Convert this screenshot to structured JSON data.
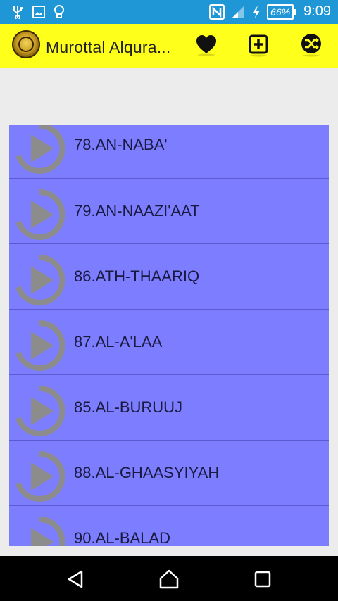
{
  "status_bar": {
    "battery_percent": "66%",
    "time": "9:09",
    "icons": [
      "usb-icon",
      "image-icon",
      "lightbulb-icon",
      "nfc-icon",
      "signal-icon",
      "charging-icon",
      "battery-icon"
    ]
  },
  "app_bar": {
    "title": "Murottal Alqura...",
    "background_color": "#ffff1c",
    "actions": [
      "heart-icon",
      "add-box-icon",
      "shuffle-icon"
    ]
  },
  "list": {
    "background_color": "#7c7dff",
    "items": [
      {
        "label": "78.AN-NABA'"
      },
      {
        "label": "79.AN-NAAZI'AAT"
      },
      {
        "label": "86.ATH-THAARIQ"
      },
      {
        "label": "87.AL-A'LAA"
      },
      {
        "label": "85.AL-BURUUJ"
      },
      {
        "label": "88.AL-GHAASYIYAH"
      },
      {
        "label": "90.AL-BALAD"
      }
    ]
  },
  "nav_bar": {
    "buttons": [
      "back-icon",
      "home-icon",
      "recent-apps-icon"
    ]
  }
}
